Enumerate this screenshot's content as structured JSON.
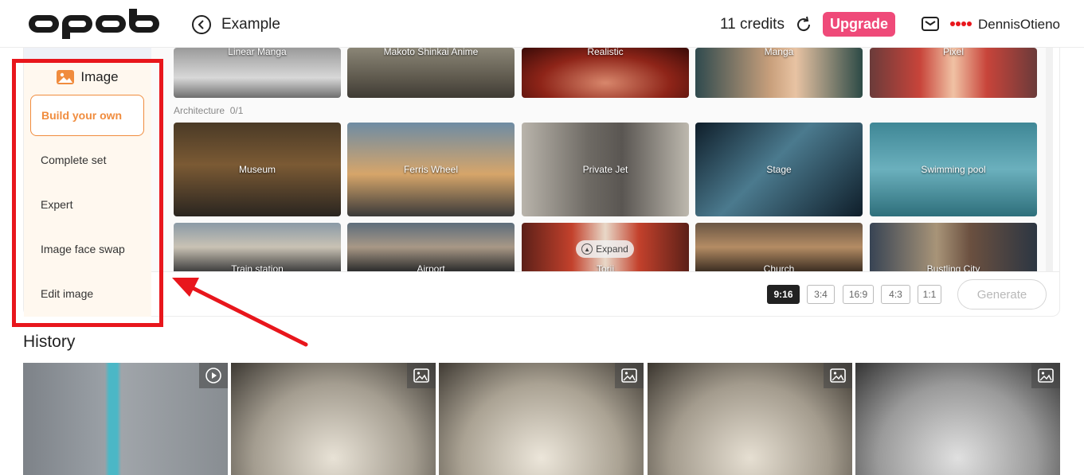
{
  "header": {
    "page_title": "Example",
    "credits": "11 credits",
    "upgrade_label": "Upgrade",
    "username": "DennisOtieno",
    "icons": [
      "apob-logo",
      "back-arrow-icon",
      "refresh-icon",
      "mail-icon"
    ]
  },
  "sidebar": {
    "section_label": "Image",
    "items": [
      {
        "label": "Build your own",
        "active": true
      },
      {
        "label": "Complete set",
        "active": false
      },
      {
        "label": "Expert",
        "active": false
      },
      {
        "label": "Image face swap",
        "active": false
      },
      {
        "label": "Edit image",
        "active": false
      }
    ]
  },
  "styles_row": {
    "tiles": [
      {
        "label": "Linear Manga"
      },
      {
        "label": "Makoto Shinkai Anime"
      },
      {
        "label": "Realistic"
      },
      {
        "label": "Manga"
      },
      {
        "label": "Pixel"
      }
    ]
  },
  "architecture": {
    "section_label": "Architecture",
    "count": "0/1",
    "tiles": [
      {
        "label": "Museum"
      },
      {
        "label": "Ferris Wheel"
      },
      {
        "label": "Private Jet"
      },
      {
        "label": "Stage"
      },
      {
        "label": "Swimming pool"
      },
      {
        "label": "Train station"
      },
      {
        "label": "Airport"
      },
      {
        "label": "Torii"
      },
      {
        "label": "Church"
      },
      {
        "label": "Bustling City"
      }
    ],
    "expand_label": "Expand"
  },
  "aspect_ratios": [
    {
      "label": "9:16",
      "active": true
    },
    {
      "label": "3:4",
      "active": false
    },
    {
      "label": "16:9",
      "active": false
    },
    {
      "label": "4:3",
      "active": false
    },
    {
      "label": "1:1",
      "active": false
    }
  ],
  "generate_label": "Generate",
  "history": {
    "title": "History",
    "items": [
      {
        "type": "video",
        "icon": "play-icon"
      },
      {
        "type": "image",
        "icon": "image-icon"
      },
      {
        "type": "image",
        "icon": "image-icon"
      },
      {
        "type": "image",
        "icon": "image-icon"
      },
      {
        "type": "image",
        "icon": "image-icon"
      }
    ]
  },
  "colors": {
    "accent_orange": "#f08c3e",
    "upgrade_pink": "#ef4a79",
    "annotation_red": "#e8161c",
    "sidebar_bg": "#fff8ef"
  }
}
